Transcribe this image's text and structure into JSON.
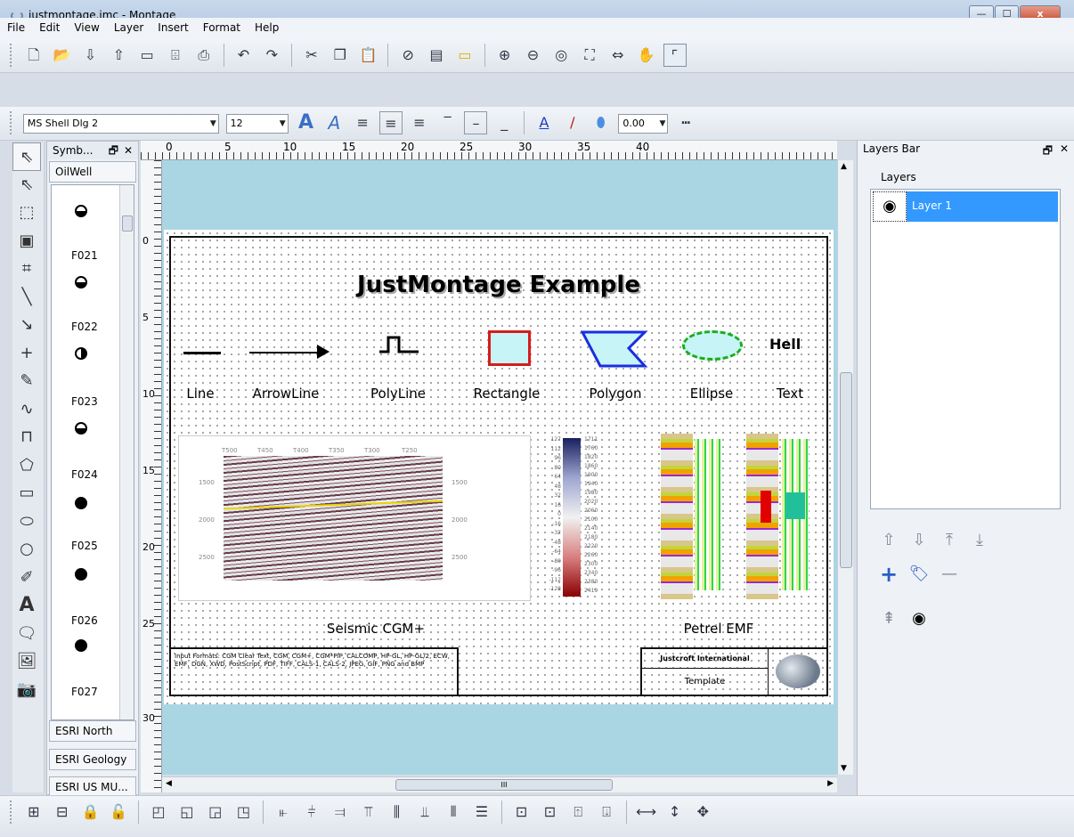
{
  "window": {
    "title": "justmontage.jmc - Montage",
    "min": "—",
    "max": "☐",
    "close": "x"
  },
  "menu": [
    "File",
    "Edit",
    "View",
    "Layer",
    "Insert",
    "Format",
    "Help"
  ],
  "format_bar": {
    "font": "MS Shell Dlg 2",
    "size": "12",
    "line_width": "0.00"
  },
  "symbol_panel": {
    "title": "Symb...",
    "top_tab": "OilWell",
    "items": [
      {
        "label": "F021"
      },
      {
        "label": "F022"
      },
      {
        "label": "F023"
      },
      {
        "label": "F024"
      },
      {
        "label": "F025"
      },
      {
        "label": "F026"
      },
      {
        "label": "F027"
      }
    ],
    "bottom_tabs": [
      "ESRI North",
      "ESRI Geology",
      "ESRI US MU..."
    ]
  },
  "rulers": {
    "h": [
      "0",
      "5",
      "10",
      "15",
      "20",
      "25",
      "30",
      "35",
      "40"
    ],
    "v": [
      "0",
      "5",
      "10",
      "15",
      "20",
      "25",
      "30"
    ]
  },
  "page": {
    "title": "JustMontage Example",
    "shapes": [
      "Line",
      "ArrowLine",
      "PolyLine",
      "Rectangle",
      "Polygon",
      "Ellipse",
      "Text"
    ],
    "text_sample": "Hell",
    "seismic_caption": "Seismic CGM+",
    "petrel_caption": "Petrel EMF",
    "seismic_x_ticks": [
      "T500",
      "T450",
      "T400",
      "T350",
      "T300",
      "T250"
    ],
    "seismic_y_ticks": [
      "1500",
      "2000",
      "2500"
    ],
    "colorbar_left": [
      "127",
      "112",
      "96",
      "80",
      "64",
      "48",
      "32",
      "16",
      "0",
      "-16",
      "-32",
      "-48",
      "-64",
      "-80",
      "-96",
      "-112",
      "-128"
    ],
    "colorbar_right": [
      "1711",
      "1760",
      "1820",
      "1860",
      "1900",
      "1940",
      "1980",
      "2020",
      "2060",
      "2100",
      "2140",
      "2180",
      "2220",
      "2260",
      "2300",
      "2340",
      "2380",
      "2419"
    ],
    "footer_text": "Input Formats: CGM Clear Text, CGM, CGM+, CGM*PIP, CALCOMP, HP-GL, HP-GL/2, ECW, EMF, DGN, XWD, PostScript, PDF, TIFF, CALS-1, CALS-2, JPEG, GIF, PNG and BMP",
    "company": "Justcroft International",
    "template": "Template"
  },
  "layers_panel": {
    "title": "Layers Bar",
    "section": "Layers",
    "layers": [
      {
        "name": "Layer 1",
        "visible": true
      }
    ]
  },
  "scroll_label": "III"
}
